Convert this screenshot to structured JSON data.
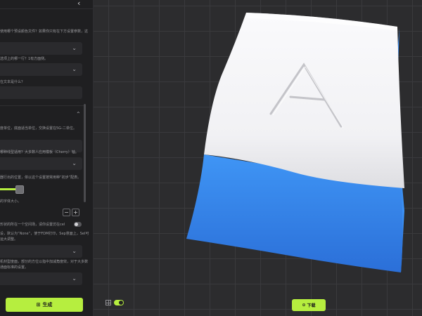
{
  "panel": {
    "collapse_glyph": "‹",
    "lines": [
      "使用哪个预设颜色文件？如果你只有在下方设置参数，这",
      "选项上的哪一行？1有方面侧。",
      "在文本是什么？",
      "度单位，底面适当单位，交换设置在5G-二单位。",
      "哪种线型适用？大多数人应用模板（Cherry）轴。",
      "器行出的位置，依以这个设置按常用种“初步”配表。",
      "的字体大小。",
      "形状的所在一个空间场，请你设置仿在cel",
      "设，默认为“None”，使于FDM打印，Sep意面上，Sel可",
      "运大调整。",
      "机材型度面，部分的方位以指中加减角度效，对于大多数",
      "通面标准的设置。"
    ],
    "stepper": {
      "minus": "−",
      "plus": "+"
    }
  },
  "buttons": {
    "generate": "生成",
    "download": "下载"
  },
  "icons": {
    "generate": "⊞",
    "download": "⊙"
  },
  "keycap": {
    "legend": "A",
    "top_color": "#f4f4f6",
    "side_color": "#3a8bef"
  },
  "slider": {
    "value_fraction": 0.75
  },
  "colors": {
    "accent": "#b6ee3f"
  }
}
